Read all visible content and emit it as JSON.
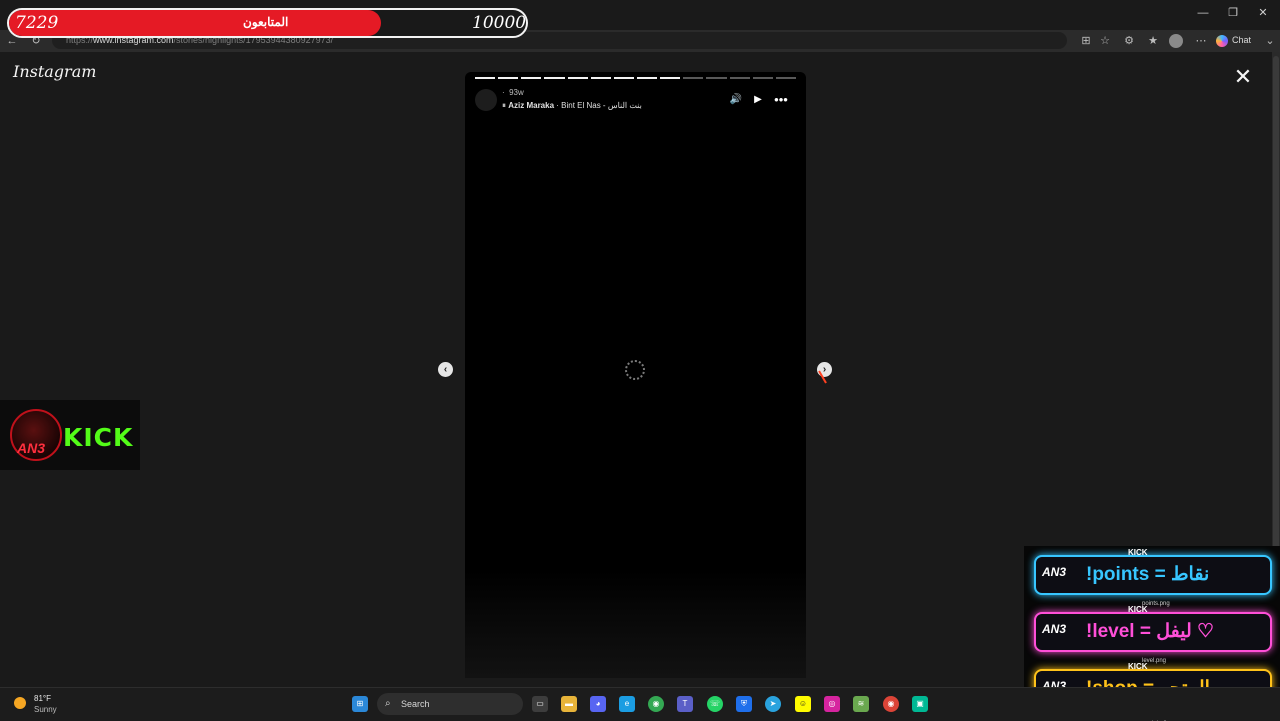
{
  "browser": {
    "url_prefix": "https://",
    "url_domain": "www.instagram.com",
    "url_path": "/stories/highlights/17953944380927973/",
    "chat_label": "Chat"
  },
  "followers_overlay": {
    "current": "7229",
    "label": "المتابعون",
    "goal": "10000",
    "progress_fraction": 0.72
  },
  "instagram": {
    "logo": "Instagram",
    "story": {
      "segments_total": 14,
      "segments_done": 9,
      "time_ago": "93w",
      "music_artist": "Aziz Maraka",
      "music_title": "Bint El Nas - بنت الناس"
    }
  },
  "kick_overlay": {
    "badge": "AN3",
    "brand": "KICK"
  },
  "commands": [
    {
      "tag": "KICK",
      "text": "!points = نقاط",
      "file": "points.png",
      "color": "#37c6ff"
    },
    {
      "tag": "KICK",
      "text": "!level = ليفل ♡",
      "file": "level.png",
      "color": "#ff4fd8"
    },
    {
      "tag": "KICK",
      "text": "!shop = المتجر",
      "file": "shop.png",
      "color": "#ffc21a"
    }
  ],
  "taskbar": {
    "temperature": "81°F",
    "condition": "Sunny",
    "search_label": "Search"
  }
}
